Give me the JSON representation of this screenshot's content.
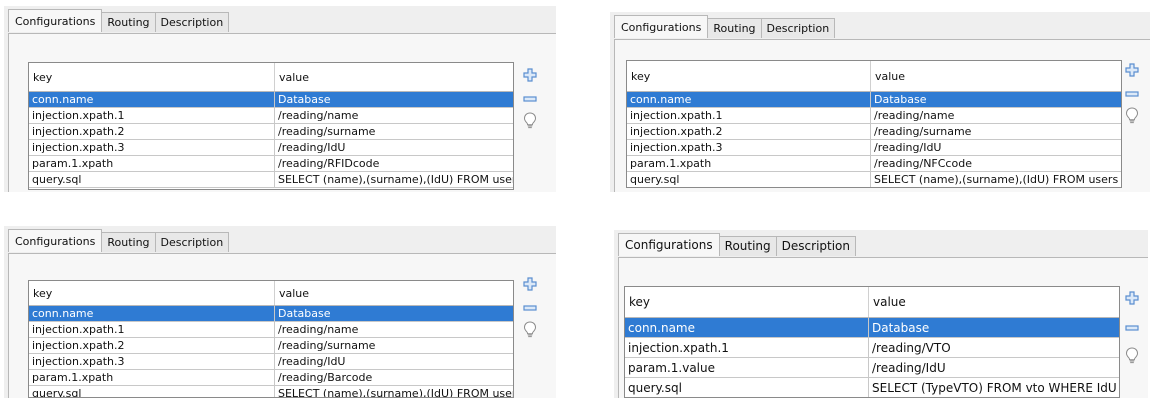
{
  "colors": {
    "selection": "#2f7bd3",
    "icon_blue": "#5b8fd0",
    "bulb_gray": "#8a8a8a"
  },
  "icons": {
    "add": "plus-icon",
    "remove": "minus-icon",
    "hint": "lightbulb-icon"
  },
  "panels": [
    {
      "tabs": [
        "Configurations",
        "Routing",
        "Description"
      ],
      "columns": {
        "key": "key",
        "value": "value"
      },
      "rows": [
        {
          "key": "conn.name",
          "value": "Database",
          "selected": true
        },
        {
          "key": "injection.xpath.1",
          "value": "/reading/name"
        },
        {
          "key": "injection.xpath.2",
          "value": "/reading/surname"
        },
        {
          "key": "injection.xpath.3",
          "value": "/reading/IdU"
        },
        {
          "key": "param.1.xpath",
          "value": "/reading/RFIDcode"
        },
        {
          "key": "query.sql",
          "value": "SELECT (name),(surname),(IdU) FROM users WH..."
        }
      ]
    },
    {
      "tabs": [
        "Configurations",
        "Routing",
        "Description"
      ],
      "columns": {
        "key": "key",
        "value": "value"
      },
      "rows": [
        {
          "key": "conn.name",
          "value": "Database",
          "selected": true
        },
        {
          "key": "injection.xpath.1",
          "value": "/reading/name"
        },
        {
          "key": "injection.xpath.2",
          "value": "/reading/surname"
        },
        {
          "key": "injection.xpath.3",
          "value": "/reading/IdU"
        },
        {
          "key": "param.1.xpath",
          "value": "/reading/NFCcode"
        },
        {
          "key": "query.sql",
          "value": "SELECT (name),(surname),(IdU) FROM users WH..."
        }
      ]
    },
    {
      "tabs": [
        "Configurations",
        "Routing",
        "Description"
      ],
      "columns": {
        "key": "key",
        "value": "value"
      },
      "rows": [
        {
          "key": "conn.name",
          "value": "Database",
          "selected": true
        },
        {
          "key": "injection.xpath.1",
          "value": "/reading/name"
        },
        {
          "key": "injection.xpath.2",
          "value": "/reading/surname"
        },
        {
          "key": "injection.xpath.3",
          "value": "/reading/IdU"
        },
        {
          "key": "param.1.xpath",
          "value": "/reading/Barcode"
        },
        {
          "key": "query.sql",
          "value": "SELECT (name),(surname),(IdU) FROM users WH..."
        }
      ]
    },
    {
      "tabs": [
        "Configurations",
        "Routing",
        "Description"
      ],
      "columns": {
        "key": "key",
        "value": "value"
      },
      "rows": [
        {
          "key": "conn.name",
          "value": "Database",
          "selected": true
        },
        {
          "key": "injection.xpath.1",
          "value": "/reading/VTO"
        },
        {
          "key": "param.1.value",
          "value": "/reading/IdU"
        },
        {
          "key": "query.sql",
          "value": "SELECT (TypeVTO) FROM vto WHERE IdU = ?"
        }
      ]
    }
  ]
}
